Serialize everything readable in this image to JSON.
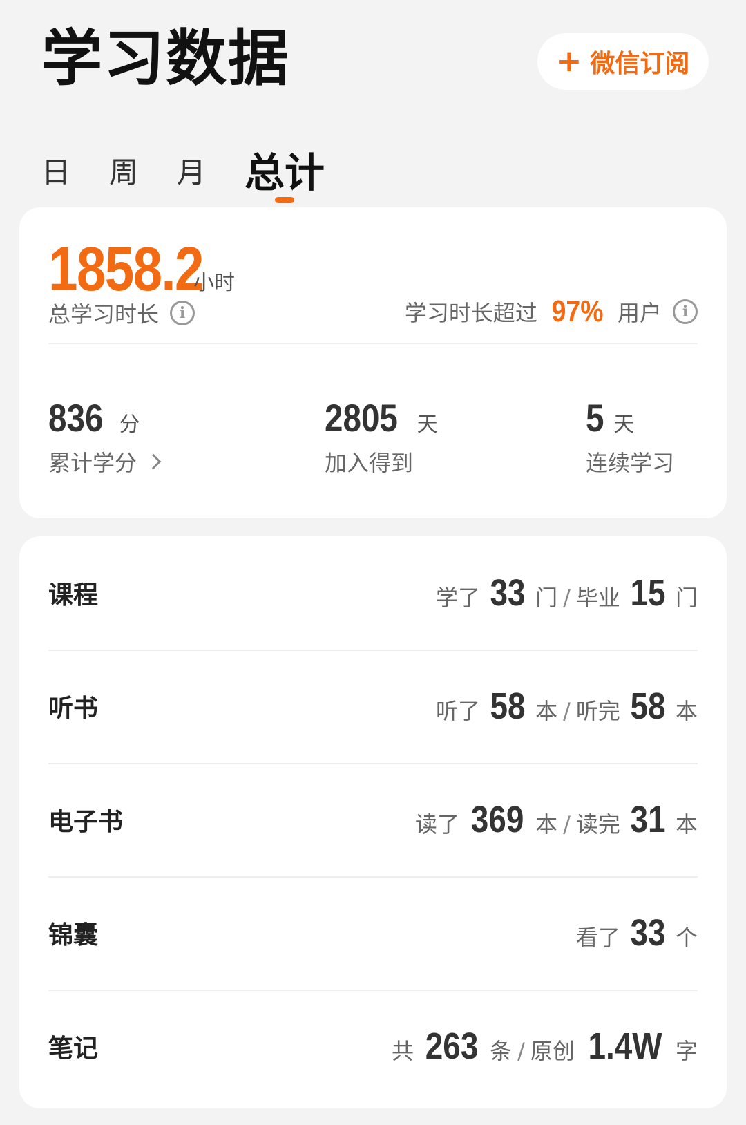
{
  "header": {
    "title": "学习数据",
    "subscribe_icon": "plus-icon",
    "subscribe_label": "微信订阅"
  },
  "tabs": [
    {
      "label": "日",
      "active": false
    },
    {
      "label": "周",
      "active": false
    },
    {
      "label": "月",
      "active": false
    },
    {
      "label": "总计",
      "active": true
    }
  ],
  "summary": {
    "total_hours": "1858.2",
    "hours_unit": "小时",
    "total_label": "总学习时长",
    "percent_prefix": "学习时长超过",
    "percent_value": "97%",
    "percent_suffix": "用户",
    "stats": [
      {
        "num": "836",
        "unit": "分",
        "label": "累计学分"
      },
      {
        "num": "2805",
        "unit": "天",
        "label": "加入得到"
      },
      {
        "num": "5",
        "unit": "天",
        "label": "连续学习"
      }
    ]
  },
  "rows": {
    "course": {
      "name": "课程",
      "p1": "学了",
      "v1": "33",
      "u1": "门",
      "sep": "/",
      "p2": "毕业",
      "v2": "15",
      "u2": "门"
    },
    "audio": {
      "name": "听书",
      "p1": "听了",
      "v1": "58",
      "u1": "本",
      "sep": "/",
      "p2": "听完",
      "v2": "58",
      "u2": "本"
    },
    "ebook": {
      "name": "电子书",
      "p1": "读了",
      "v1": "369",
      "u1": "本",
      "sep": "/",
      "p2": "读完",
      "v2": "31",
      "u2": "本"
    },
    "tips": {
      "name": "锦囊",
      "p1": "看了",
      "v1": "33",
      "u1": "个"
    },
    "notes": {
      "name": "笔记",
      "p1": "共",
      "v1": "263",
      "u1": "条",
      "sep": "/",
      "p2": "原创",
      "v2": "1.4W",
      "u2": "字"
    }
  },
  "colors": {
    "accent": "#f26b12",
    "background": "#f3f3f3",
    "card": "#ffffff"
  }
}
